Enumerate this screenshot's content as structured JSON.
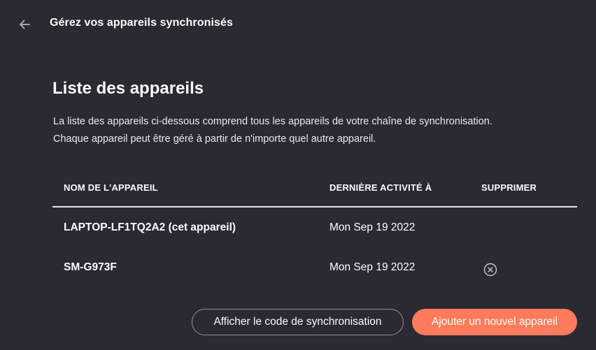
{
  "header": {
    "back_icon": "arrow-left-icon",
    "title": "Gérez vos appareils synchronisés"
  },
  "section": {
    "title": "Liste des appareils",
    "description_line1": "La liste des appareils ci-dessous comprend tous les appareils de votre chaîne de synchronisation.",
    "description_line2": "Chaque appareil peut être géré à partir de n'importe quel autre appareil."
  },
  "table": {
    "columns": [
      "NOM DE L'APPAREIL",
      "DERNIÈRE ACTIVITÉ À",
      "SUPPRIMER"
    ],
    "rows": [
      {
        "name": "LAPTOP-LF1TQ2A2 (cet appareil)",
        "last_activity": "Mon Sep 19 2022",
        "deletable": false
      },
      {
        "name": "SM-G973F",
        "last_activity": "Mon Sep 19 2022",
        "deletable": true,
        "delete_icon": "circle-x-icon"
      }
    ]
  },
  "footer": {
    "show_code_label": "Afficher le code de synchronisation",
    "add_device_label": "Ajouter un nouvel appareil"
  },
  "colors": {
    "background": "#2b2a33",
    "text": "#fbfbfe",
    "accent": "#ff7b5c",
    "divider": "#e5e5ea",
    "secondary_border": "#8f8f9d"
  }
}
